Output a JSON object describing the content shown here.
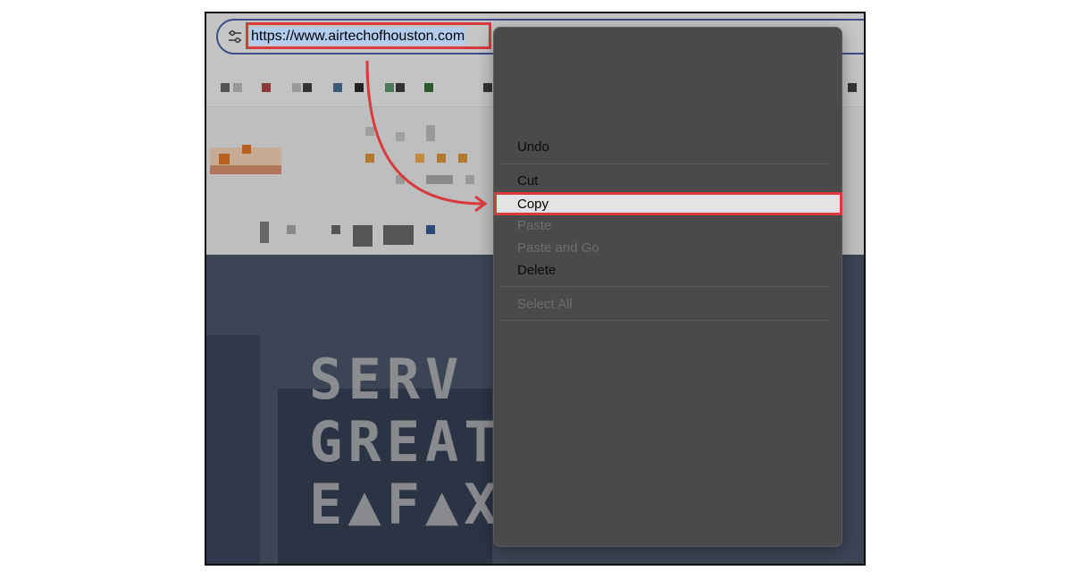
{
  "browser": {
    "url": "https://www.airtechofhouston.com",
    "site_icon": "tune-icon"
  },
  "context_menu": {
    "items": [
      {
        "label": "Undo",
        "enabled": true
      },
      {
        "label": "Cut",
        "enabled": true
      },
      {
        "label": "Copy",
        "enabled": true,
        "highlighted": true
      },
      {
        "label": "Paste",
        "enabled": false
      },
      {
        "label": "Paste and Go",
        "enabled": false
      },
      {
        "label": "Delete",
        "enabled": true
      },
      {
        "label": "Select All",
        "enabled": false
      }
    ]
  },
  "annotation": {
    "highlight_color": "#d93a3e",
    "selection_color": "#b3cdf0"
  }
}
